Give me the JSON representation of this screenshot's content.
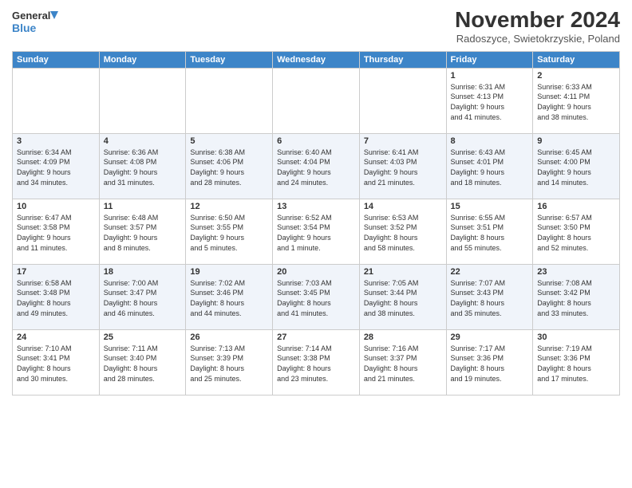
{
  "header": {
    "logo_line1": "General",
    "logo_line2": "Blue",
    "month": "November 2024",
    "location": "Radoszyce, Swietokrzyskie, Poland"
  },
  "weekdays": [
    "Sunday",
    "Monday",
    "Tuesday",
    "Wednesday",
    "Thursday",
    "Friday",
    "Saturday"
  ],
  "weeks": [
    [
      {
        "day": "",
        "info": ""
      },
      {
        "day": "",
        "info": ""
      },
      {
        "day": "",
        "info": ""
      },
      {
        "day": "",
        "info": ""
      },
      {
        "day": "",
        "info": ""
      },
      {
        "day": "1",
        "info": "Sunrise: 6:31 AM\nSunset: 4:13 PM\nDaylight: 9 hours\nand 41 minutes."
      },
      {
        "day": "2",
        "info": "Sunrise: 6:33 AM\nSunset: 4:11 PM\nDaylight: 9 hours\nand 38 minutes."
      }
    ],
    [
      {
        "day": "3",
        "info": "Sunrise: 6:34 AM\nSunset: 4:09 PM\nDaylight: 9 hours\nand 34 minutes."
      },
      {
        "day": "4",
        "info": "Sunrise: 6:36 AM\nSunset: 4:08 PM\nDaylight: 9 hours\nand 31 minutes."
      },
      {
        "day": "5",
        "info": "Sunrise: 6:38 AM\nSunset: 4:06 PM\nDaylight: 9 hours\nand 28 minutes."
      },
      {
        "day": "6",
        "info": "Sunrise: 6:40 AM\nSunset: 4:04 PM\nDaylight: 9 hours\nand 24 minutes."
      },
      {
        "day": "7",
        "info": "Sunrise: 6:41 AM\nSunset: 4:03 PM\nDaylight: 9 hours\nand 21 minutes."
      },
      {
        "day": "8",
        "info": "Sunrise: 6:43 AM\nSunset: 4:01 PM\nDaylight: 9 hours\nand 18 minutes."
      },
      {
        "day": "9",
        "info": "Sunrise: 6:45 AM\nSunset: 4:00 PM\nDaylight: 9 hours\nand 14 minutes."
      }
    ],
    [
      {
        "day": "10",
        "info": "Sunrise: 6:47 AM\nSunset: 3:58 PM\nDaylight: 9 hours\nand 11 minutes."
      },
      {
        "day": "11",
        "info": "Sunrise: 6:48 AM\nSunset: 3:57 PM\nDaylight: 9 hours\nand 8 minutes."
      },
      {
        "day": "12",
        "info": "Sunrise: 6:50 AM\nSunset: 3:55 PM\nDaylight: 9 hours\nand 5 minutes."
      },
      {
        "day": "13",
        "info": "Sunrise: 6:52 AM\nSunset: 3:54 PM\nDaylight: 9 hours\nand 1 minute."
      },
      {
        "day": "14",
        "info": "Sunrise: 6:53 AM\nSunset: 3:52 PM\nDaylight: 8 hours\nand 58 minutes."
      },
      {
        "day": "15",
        "info": "Sunrise: 6:55 AM\nSunset: 3:51 PM\nDaylight: 8 hours\nand 55 minutes."
      },
      {
        "day": "16",
        "info": "Sunrise: 6:57 AM\nSunset: 3:50 PM\nDaylight: 8 hours\nand 52 minutes."
      }
    ],
    [
      {
        "day": "17",
        "info": "Sunrise: 6:58 AM\nSunset: 3:48 PM\nDaylight: 8 hours\nand 49 minutes."
      },
      {
        "day": "18",
        "info": "Sunrise: 7:00 AM\nSunset: 3:47 PM\nDaylight: 8 hours\nand 46 minutes."
      },
      {
        "day": "19",
        "info": "Sunrise: 7:02 AM\nSunset: 3:46 PM\nDaylight: 8 hours\nand 44 minutes."
      },
      {
        "day": "20",
        "info": "Sunrise: 7:03 AM\nSunset: 3:45 PM\nDaylight: 8 hours\nand 41 minutes."
      },
      {
        "day": "21",
        "info": "Sunrise: 7:05 AM\nSunset: 3:44 PM\nDaylight: 8 hours\nand 38 minutes."
      },
      {
        "day": "22",
        "info": "Sunrise: 7:07 AM\nSunset: 3:43 PM\nDaylight: 8 hours\nand 35 minutes."
      },
      {
        "day": "23",
        "info": "Sunrise: 7:08 AM\nSunset: 3:42 PM\nDaylight: 8 hours\nand 33 minutes."
      }
    ],
    [
      {
        "day": "24",
        "info": "Sunrise: 7:10 AM\nSunset: 3:41 PM\nDaylight: 8 hours\nand 30 minutes."
      },
      {
        "day": "25",
        "info": "Sunrise: 7:11 AM\nSunset: 3:40 PM\nDaylight: 8 hours\nand 28 minutes."
      },
      {
        "day": "26",
        "info": "Sunrise: 7:13 AM\nSunset: 3:39 PM\nDaylight: 8 hours\nand 25 minutes."
      },
      {
        "day": "27",
        "info": "Sunrise: 7:14 AM\nSunset: 3:38 PM\nDaylight: 8 hours\nand 23 minutes."
      },
      {
        "day": "28",
        "info": "Sunrise: 7:16 AM\nSunset: 3:37 PM\nDaylight: 8 hours\nand 21 minutes."
      },
      {
        "day": "29",
        "info": "Sunrise: 7:17 AM\nSunset: 3:36 PM\nDaylight: 8 hours\nand 19 minutes."
      },
      {
        "day": "30",
        "info": "Sunrise: 7:19 AM\nSunset: 3:36 PM\nDaylight: 8 hours\nand 17 minutes."
      }
    ]
  ]
}
